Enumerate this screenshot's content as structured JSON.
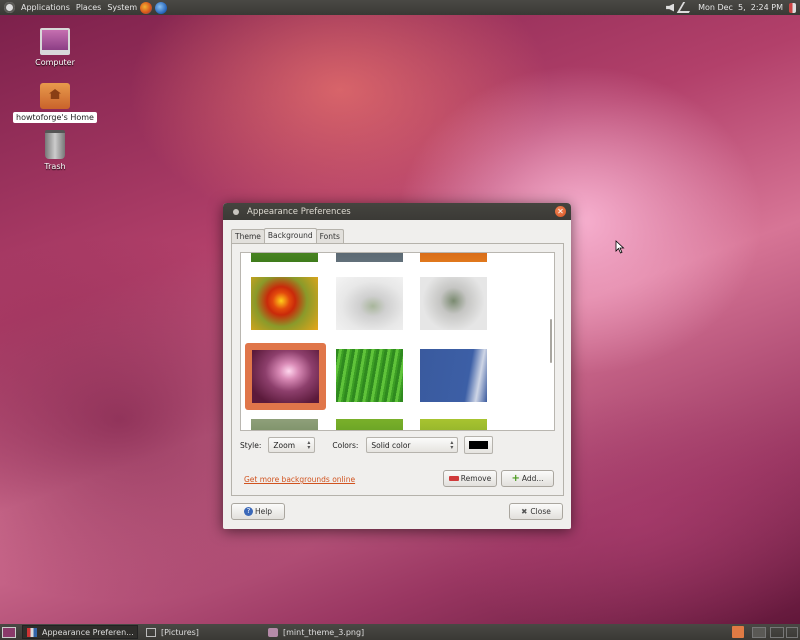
{
  "top_panel": {
    "menus": [
      "Applications",
      "Places",
      "System"
    ],
    "clock": "Mon Dec  5,  2:24 PM",
    "icons": [
      "ubuntu-logo-icon",
      "firefox-icon",
      "thunderbird-icon",
      "sound-icon",
      "network-icon",
      "power-icon"
    ]
  },
  "desktop": {
    "icons": [
      {
        "label": "Computer",
        "icon": "computer-icon"
      },
      {
        "label": "howtoforge's Home",
        "icon": "home-folder-icon"
      },
      {
        "label": "Trash",
        "icon": "trash-icon"
      }
    ]
  },
  "window": {
    "title": "Appearance Preferences",
    "tabs": [
      "Theme",
      "Background",
      "Fonts"
    ],
    "active_tab": "Background",
    "style_label": "Style:",
    "style_value": "Zoom",
    "colors_label": "Colors:",
    "colors_value": "Solid color",
    "color_swatch": "#000000",
    "more_link": "Get more backgrounds online",
    "remove_label": "Remove",
    "add_label": "Add...",
    "help_label": "Help",
    "close_label": "Close",
    "selected_wallpaper_accent": "#e0764a"
  },
  "taskbar": {
    "tasks": [
      "Appearance Preferen...",
      "[Pictures]",
      "[mint_theme_3.png]"
    ]
  },
  "colors": {
    "panel": "#3c3b37",
    "accent_orange": "#dd4814",
    "link": "#d1531f"
  }
}
